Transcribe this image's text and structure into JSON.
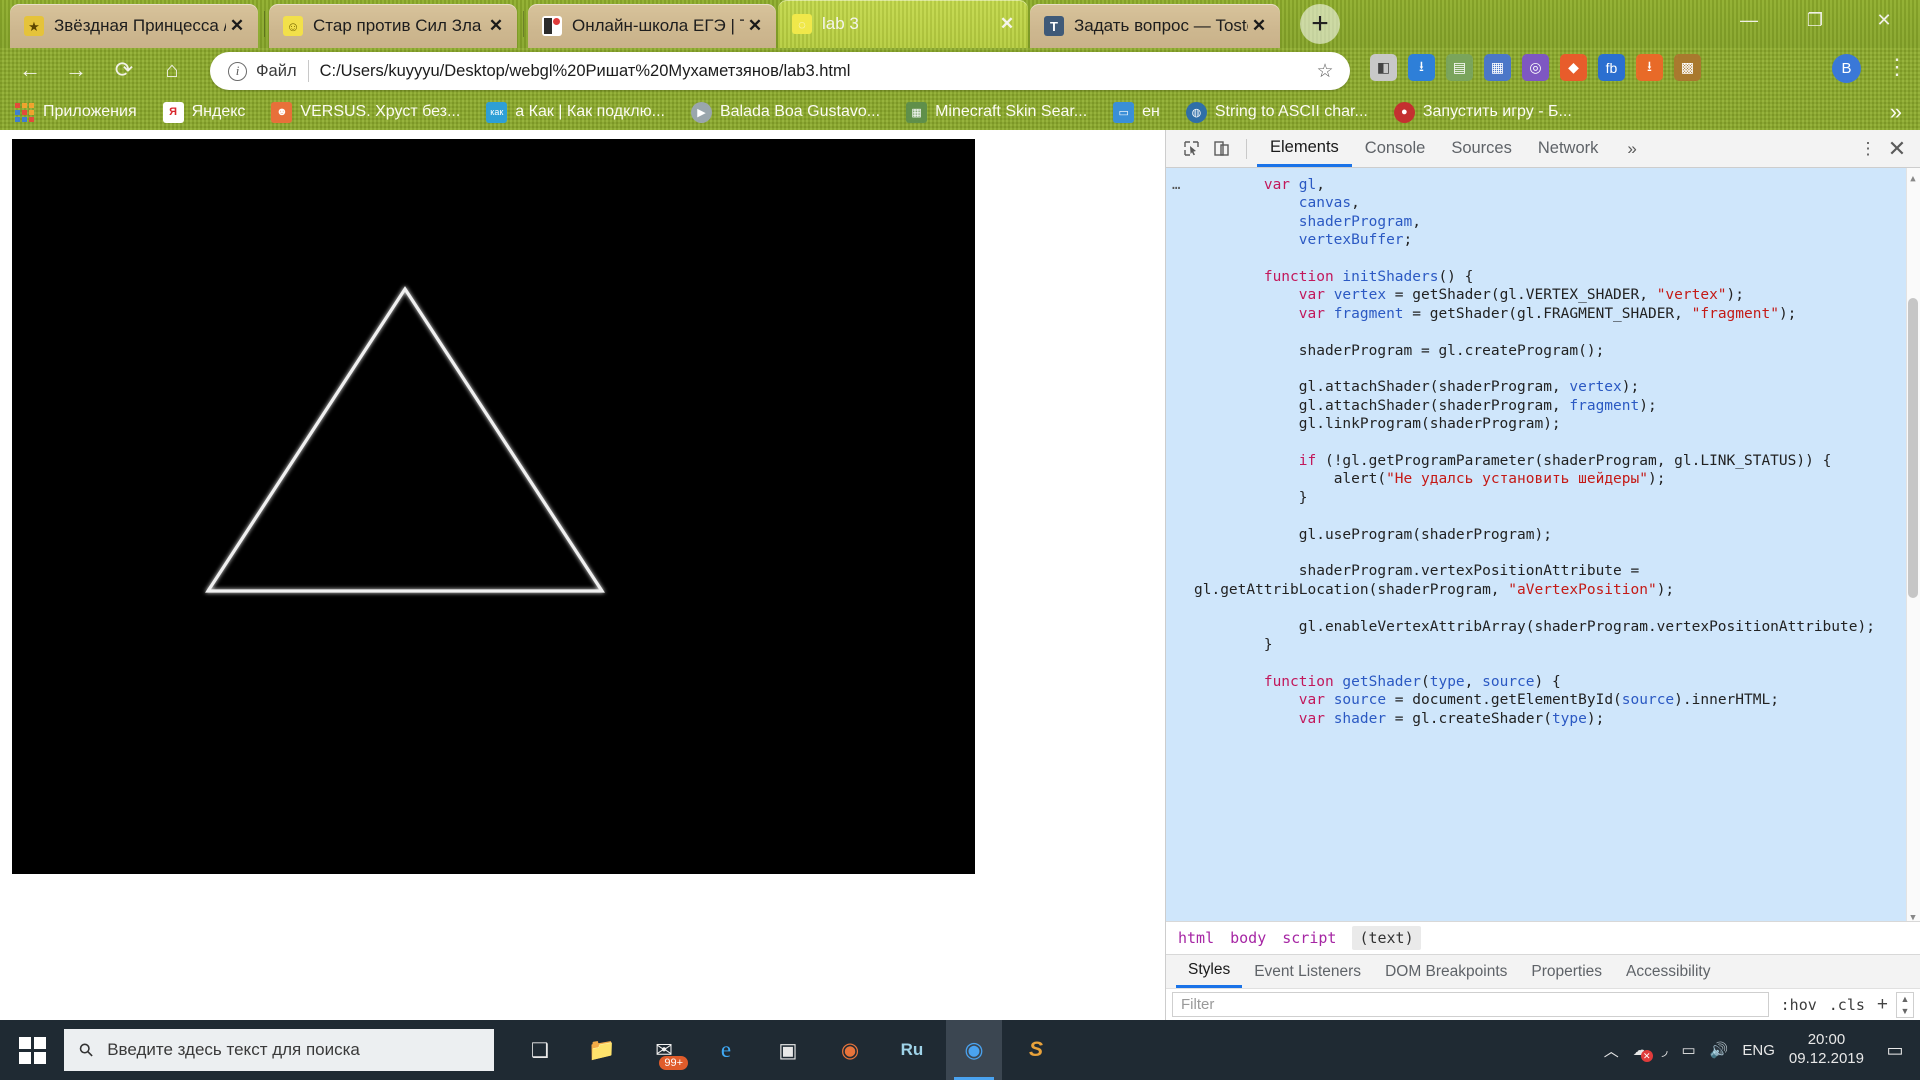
{
  "browser": {
    "tabs": [
      {
        "title": "Звёздная Принцесса / Ста",
        "favicon": "star-princess-icon",
        "active": false
      },
      {
        "title": "Стар против Сил Зла / Зве",
        "favicon": "smiley-icon",
        "active": false
      },
      {
        "title": "Онлайн-школа ЕГЭ | Trello",
        "favicon": "trello-icon",
        "active": false
      },
      {
        "title": "lab 3",
        "favicon": "webgl-icon",
        "active": true
      },
      {
        "title": "Задать вопрос — Toster.ru",
        "favicon": "toster-icon",
        "active": false
      }
    ],
    "new_tab_label": "+",
    "close_label": "✕",
    "window_controls": {
      "minimize": "—",
      "maximize": "❐",
      "close": "✕"
    },
    "nav": {
      "back": "←",
      "forward": "→",
      "reload": "⟳",
      "home": "⌂"
    },
    "omnibox": {
      "scheme_label": "Файл",
      "url": "C:/Users/kuyyyu/Desktop/webgl%20Ришат%20Мухаметзянов/lab3.html",
      "bookmark_star": "☆",
      "info_icon": "i"
    },
    "profile_initial": "B",
    "menu_icon": "⋮",
    "bookmarks": [
      {
        "label": "Приложения",
        "icon": "apps-grid-icon",
        "color": "#d95c2b"
      },
      {
        "label": "Яндекс",
        "icon": "yandex-icon",
        "color": "#ffffff"
      },
      {
        "label": "VERSUS. Хруст без...",
        "icon": "versus-icon",
        "color": "#e8703a"
      },
      {
        "label": "а Как | Как подклю...",
        "icon": "kak-icon",
        "color": "#2e9fd6"
      },
      {
        "label": "Balada Boa Gustavo...",
        "icon": "youtube-icon",
        "color": "#9aa6ad"
      },
      {
        "label": "Minecraft Skin Sear...",
        "icon": "minecraft-icon",
        "color": "#5f8f4a"
      },
      {
        "label": "ен",
        "icon": "twitter-icon",
        "color": "#3a8fd8"
      },
      {
        "label": "String to ASCII char...",
        "icon": "globe-icon",
        "color": "#2f6fa8"
      },
      {
        "label": "Запустить игру - Б...",
        "icon": "record-icon",
        "color": "#c43030"
      }
    ],
    "bookmarks_overflow": "»"
  },
  "page": {
    "canvas_background": "#000000",
    "shape": "white-triangle-outline"
  },
  "devtools": {
    "inspect_icon": "inspect-cursor-icon",
    "device_icon": "device-toolbar-icon",
    "tabs": [
      {
        "label": "Elements",
        "active": true
      },
      {
        "label": "Console",
        "active": false
      },
      {
        "label": "Sources",
        "active": false
      },
      {
        "label": "Network",
        "active": false
      }
    ],
    "more_tabs": "»",
    "kebab": "⋮",
    "close": "✕",
    "code_ellipsis": "…",
    "code_lines": [
      {
        "indent": 4,
        "parts": [
          {
            "t": "var ",
            "c": "kw"
          },
          {
            "t": "gl",
            "c": "ident"
          },
          {
            "t": ",",
            "c": "plain"
          }
        ]
      },
      {
        "indent": 6,
        "parts": [
          {
            "t": "canvas",
            "c": "ident"
          },
          {
            "t": ",",
            "c": "plain"
          }
        ]
      },
      {
        "indent": 6,
        "parts": [
          {
            "t": "shaderProgram",
            "c": "ident"
          },
          {
            "t": ",",
            "c": "plain"
          }
        ]
      },
      {
        "indent": 6,
        "parts": [
          {
            "t": "vertexBuffer",
            "c": "ident"
          },
          {
            "t": ";",
            "c": "plain"
          }
        ]
      },
      {
        "indent": 0,
        "parts": []
      },
      {
        "indent": 4,
        "parts": [
          {
            "t": "function ",
            "c": "kw"
          },
          {
            "t": "initShaders",
            "c": "ident"
          },
          {
            "t": "() {",
            "c": "plain"
          }
        ]
      },
      {
        "indent": 6,
        "parts": [
          {
            "t": "var ",
            "c": "kw"
          },
          {
            "t": "vertex",
            "c": "ident"
          },
          {
            "t": " = getShader(gl.VERTEX_SHADER, ",
            "c": "plain"
          },
          {
            "t": "\"vertex\"",
            "c": "str"
          },
          {
            "t": ");",
            "c": "plain"
          }
        ]
      },
      {
        "indent": 6,
        "parts": [
          {
            "t": "var ",
            "c": "kw"
          },
          {
            "t": "fragment",
            "c": "ident"
          },
          {
            "t": " = getShader(gl.FRAGMENT_SHADER, ",
            "c": "plain"
          },
          {
            "t": "\"fragment\"",
            "c": "str"
          },
          {
            "t": ");",
            "c": "plain"
          }
        ]
      },
      {
        "indent": 0,
        "parts": []
      },
      {
        "indent": 6,
        "parts": [
          {
            "t": "shaderProgram = gl.createProgram();",
            "c": "plain"
          }
        ]
      },
      {
        "indent": 0,
        "parts": []
      },
      {
        "indent": 6,
        "parts": [
          {
            "t": "gl.attachShader(shaderProgram, ",
            "c": "plain"
          },
          {
            "t": "vertex",
            "c": "ident"
          },
          {
            "t": ");",
            "c": "plain"
          }
        ]
      },
      {
        "indent": 6,
        "parts": [
          {
            "t": "gl.attachShader(shaderProgram, ",
            "c": "plain"
          },
          {
            "t": "fragment",
            "c": "ident"
          },
          {
            "t": ");",
            "c": "plain"
          }
        ]
      },
      {
        "indent": 6,
        "parts": [
          {
            "t": "gl.linkProgram(shaderProgram);",
            "c": "plain"
          }
        ]
      },
      {
        "indent": 0,
        "parts": []
      },
      {
        "indent": 6,
        "parts": [
          {
            "t": "if ",
            "c": "kw"
          },
          {
            "t": "(!gl.getProgramParameter(shaderProgram, gl.LINK_STATUS)) {",
            "c": "plain"
          }
        ]
      },
      {
        "indent": 8,
        "parts": [
          {
            "t": "alert(",
            "c": "plain"
          },
          {
            "t": "\"Не удалсь установить шейдеры\"",
            "c": "str"
          },
          {
            "t": ");",
            "c": "plain"
          }
        ]
      },
      {
        "indent": 6,
        "parts": [
          {
            "t": "}",
            "c": "plain"
          }
        ]
      },
      {
        "indent": 0,
        "parts": []
      },
      {
        "indent": 6,
        "parts": [
          {
            "t": "gl.useProgram(shaderProgram);",
            "c": "plain"
          }
        ]
      },
      {
        "indent": 0,
        "parts": []
      },
      {
        "indent": 6,
        "parts": [
          {
            "t": "shaderProgram.vertexPositionAttribute = gl.getAttribLocation(shaderProgram, ",
            "c": "plain"
          },
          {
            "t": "\"aVertexPosition\"",
            "c": "str"
          },
          {
            "t": ");",
            "c": "plain"
          }
        ]
      },
      {
        "indent": 0,
        "parts": []
      },
      {
        "indent": 6,
        "parts": [
          {
            "t": "gl.enableVertexAttribArray(shaderProgram.vertexPositionAttribute);",
            "c": "plain"
          }
        ]
      },
      {
        "indent": 4,
        "parts": [
          {
            "t": "}",
            "c": "plain"
          }
        ]
      },
      {
        "indent": 0,
        "parts": []
      },
      {
        "indent": 4,
        "parts": [
          {
            "t": "function ",
            "c": "kw"
          },
          {
            "t": "getShader",
            "c": "ident"
          },
          {
            "t": "(",
            "c": "plain"
          },
          {
            "t": "type",
            "c": "ident"
          },
          {
            "t": ", ",
            "c": "plain"
          },
          {
            "t": "source",
            "c": "ident"
          },
          {
            "t": ") {",
            "c": "plain"
          }
        ]
      },
      {
        "indent": 6,
        "parts": [
          {
            "t": "var ",
            "c": "kw"
          },
          {
            "t": "source",
            "c": "ident"
          },
          {
            "t": " = document.getElementById(",
            "c": "plain"
          },
          {
            "t": "source",
            "c": "ident"
          },
          {
            "t": ").innerHTML;",
            "c": "plain"
          }
        ]
      },
      {
        "indent": 6,
        "parts": [
          {
            "t": "var ",
            "c": "kw"
          },
          {
            "t": "shader",
            "c": "ident"
          },
          {
            "t": " = gl.createShader(",
            "c": "plain"
          },
          {
            "t": "type",
            "c": "ident"
          },
          {
            "t": ");",
            "c": "plain"
          }
        ]
      }
    ],
    "breadcrumb": [
      {
        "label": "html",
        "selected": false
      },
      {
        "label": "body",
        "selected": false
      },
      {
        "label": "script",
        "selected": false
      },
      {
        "label": "(text)",
        "selected": true
      }
    ],
    "styles_tabs": [
      {
        "label": "Styles",
        "active": true
      },
      {
        "label": "Event Listeners",
        "active": false
      },
      {
        "label": "DOM Breakpoints",
        "active": false
      },
      {
        "label": "Properties",
        "active": false
      },
      {
        "label": "Accessibility",
        "active": false
      }
    ],
    "filter_placeholder": "Filter",
    "filter_value": "",
    "hov_label": ":hov",
    "cls_label": ".cls",
    "plus_label": "+"
  },
  "taskbar": {
    "start_icon": "windows-logo-icon",
    "search_placeholder": "Введите здесь текст для поиска",
    "search_icon": "search-icon",
    "buttons": [
      {
        "name": "task-view-icon",
        "glyph": "❏"
      },
      {
        "name": "file-explorer-icon",
        "glyph": "📁"
      },
      {
        "name": "mail-icon",
        "glyph": "✉",
        "badge": "99+"
      },
      {
        "name": "edge-icon",
        "glyph": "e"
      },
      {
        "name": "store-icon",
        "glyph": "▣"
      },
      {
        "name": "firefox-icon",
        "glyph": "🦊"
      },
      {
        "name": "photoshop-icon",
        "glyph": "Ru"
      },
      {
        "name": "chrome-icon",
        "glyph": "◉",
        "active": true
      },
      {
        "name": "sublime-icon",
        "glyph": "S"
      }
    ],
    "tray": {
      "chevron": "︿",
      "cloud_error": "☁",
      "wifi": "◞",
      "battery": "▭",
      "volume": "🔊",
      "language": "ENG",
      "time": "20:00",
      "date": "09.12.2019",
      "notifications": "▭"
    }
  }
}
